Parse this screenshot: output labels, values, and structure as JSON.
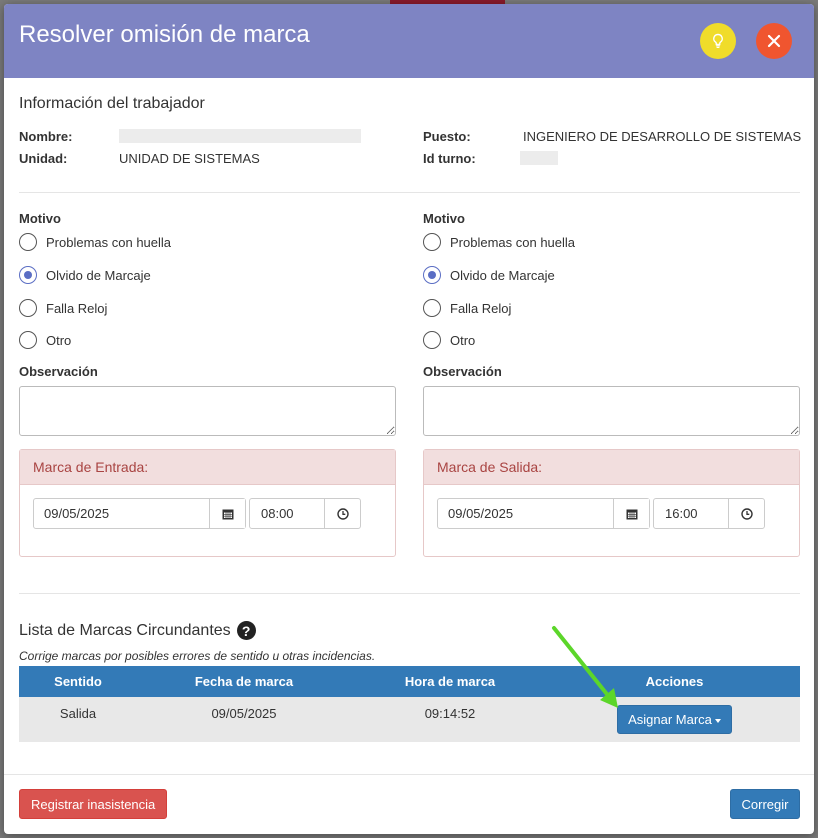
{
  "modal": {
    "title": "Resolver omisión de marca"
  },
  "worker_info": {
    "section_title": "Información del trabajador",
    "nombre_label": "Nombre:",
    "unidad_label": "Unidad:",
    "unidad_value": "UNIDAD DE SISTEMAS",
    "puesto_label": "Puesto:",
    "puesto_value": "INGENIERO DE DESARROLLO DE SISTEMAS",
    "turno_label": "Id turno:"
  },
  "motivo_left": {
    "label": "Motivo",
    "options": [
      "Problemas con huella",
      "Olvido de Marcaje",
      "Falla Reloj",
      "Otro"
    ],
    "selected": "Olvido de Marcaje",
    "observacion_label": "Observación"
  },
  "motivo_right": {
    "label": "Motivo",
    "options": [
      "Problemas con huella",
      "Olvido de Marcaje",
      "Falla Reloj",
      "Otro"
    ],
    "selected": "Olvido de Marcaje",
    "observacion_label": "Observación"
  },
  "entrada": {
    "title": "Marca de Entrada:",
    "date": "09/05/2025",
    "time": "08:00"
  },
  "salida": {
    "title": "Marca de Salida:",
    "date": "09/05/2025",
    "time": "16:00"
  },
  "marks_list": {
    "title": "Lista de Marcas Circundantes",
    "subtitle": "Corrige marcas por posibles errores de sentido u otras incidencias.",
    "columns": [
      "Sentido",
      "Fecha de marca",
      "Hora de marca",
      "Acciones"
    ],
    "rows": [
      {
        "sentido": "Salida",
        "fecha": "09/05/2025",
        "hora": "09:14:52",
        "action_label": "Asignar Marca"
      }
    ]
  },
  "footer": {
    "register_absence": "Registrar inasistencia",
    "correct": "Corregir"
  },
  "colors": {
    "header": "#7e84c3",
    "bulb_button": "#f0dc2a",
    "close_button": "#f0552f",
    "primary": "#337ab7",
    "danger": "#d9534f",
    "panel_heading_bg": "#f2dede",
    "panel_heading_text": "#a94442",
    "annotation_arrow": "#5cd62a"
  },
  "icons": {
    "bulb": "lightbulb-icon",
    "close": "close-icon",
    "calendar": "calendar-icon",
    "clock": "clock-icon",
    "help": "question-circle-icon"
  }
}
